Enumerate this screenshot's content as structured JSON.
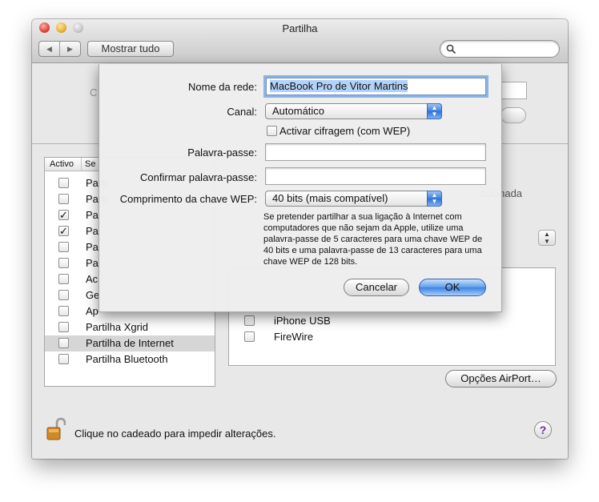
{
  "window": {
    "title": "Partilha",
    "nav": {
      "back": "◀",
      "forward": "▶"
    },
    "show_all": "Mostrar tudo",
    "search_placeholder": ""
  },
  "services": {
    "header_active": "Activo",
    "header_service": "Se",
    "items": [
      {
        "label": "Parti",
        "checked": false
      },
      {
        "label": "Parti",
        "checked": false
      },
      {
        "label": "Pa",
        "checked": true
      },
      {
        "label": "Pa",
        "checked": true
      },
      {
        "label": "Pa",
        "checked": false
      },
      {
        "label": "Pa",
        "checked": false
      },
      {
        "label": "Ac",
        "checked": false
      },
      {
        "label": "Ge",
        "checked": false
      },
      {
        "label": "Ap",
        "checked": false
      },
      {
        "label": "Partilha Xgrid",
        "checked": false
      },
      {
        "label": "Partilha de Internet",
        "checked": false,
        "selected": true
      },
      {
        "label": "Partilha Bluetooth",
        "checked": false
      }
    ]
  },
  "ports": [
    {
      "label": "iPhone USB",
      "checked": false
    },
    {
      "label": "FireWire",
      "checked": false
    }
  ],
  "background_fragments": {
    "c": "C",
    "seleccionada": "ccionada"
  },
  "airport_options": "Opções AirPort…",
  "lock_text": "Clique no cadeado para impedir alterações.",
  "help": "?",
  "sheet": {
    "network_name_label": "Nome da rede:",
    "network_name_value": "MacBook Pro de Vitor Martins",
    "channel_label": "Canal:",
    "channel_value": "Automático",
    "encryption_label": "Activar cifragem (com WEP)",
    "encryption_checked": false,
    "password_label": "Palavra-passe:",
    "password_value": "",
    "confirm_label": "Confirmar palavra-passe:",
    "confirm_value": "",
    "key_length_label": "Comprimento da chave WEP:",
    "key_length_value": "40 bits (mais compatível)",
    "note": "Se pretender partilhar a sua ligação à Internet com computadores que não sejam da Apple, utilize uma palavra-passe de 5 caracteres para uma chave WEP de 40 bits e uma palavra-passe de 13 caracteres para uma chave WEP de 128 bits.",
    "cancel": "Cancelar",
    "ok": "OK"
  }
}
